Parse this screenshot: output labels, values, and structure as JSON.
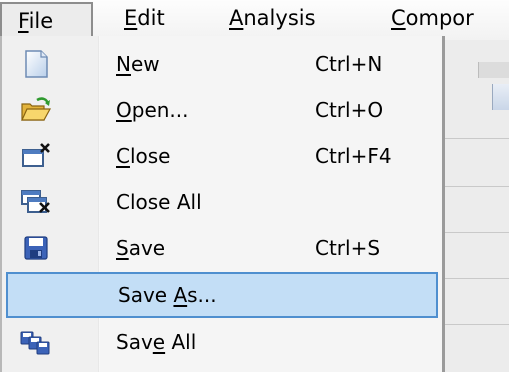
{
  "menubar": {
    "items": [
      {
        "label": "File",
        "mnemonic": "F",
        "rest": "ile"
      },
      {
        "label": "Edit",
        "mnemonic": "E",
        "rest": "dit"
      },
      {
        "label": "Analysis",
        "mnemonic": "A",
        "rest": "nalysis"
      },
      {
        "label": "Compor",
        "mnemonic": "C",
        "rest": "ompor"
      }
    ]
  },
  "file_menu": {
    "items": [
      {
        "pre": "",
        "mnemonic": "N",
        "post": "ew",
        "shortcut": "Ctrl+N",
        "icon": "new-document-icon"
      },
      {
        "pre": "",
        "mnemonic": "O",
        "post": "pen...",
        "shortcut": "Ctrl+O",
        "icon": "open-folder-icon"
      },
      {
        "pre": "",
        "mnemonic": "C",
        "post": "lose",
        "shortcut": "Ctrl+F4",
        "icon": "close-document-icon"
      },
      {
        "pre": "Close All",
        "mnemonic": "",
        "post": "",
        "shortcut": "",
        "icon": "close-all-icon"
      },
      {
        "pre": "",
        "mnemonic": "S",
        "post": "ave",
        "shortcut": "Ctrl+S",
        "icon": "floppy-disk-icon"
      },
      {
        "pre": "Save ",
        "mnemonic": "A",
        "post": "s...",
        "shortcut": "",
        "icon": "",
        "highlighted": true
      },
      {
        "pre": "Sav",
        "mnemonic": "e",
        "post": " All",
        "shortcut": "",
        "icon": "save-all-icon"
      }
    ]
  },
  "colors": {
    "highlight_fill": "#c3def6",
    "highlight_border": "#4f8fcf",
    "menu_background": "#f5f5f5"
  }
}
